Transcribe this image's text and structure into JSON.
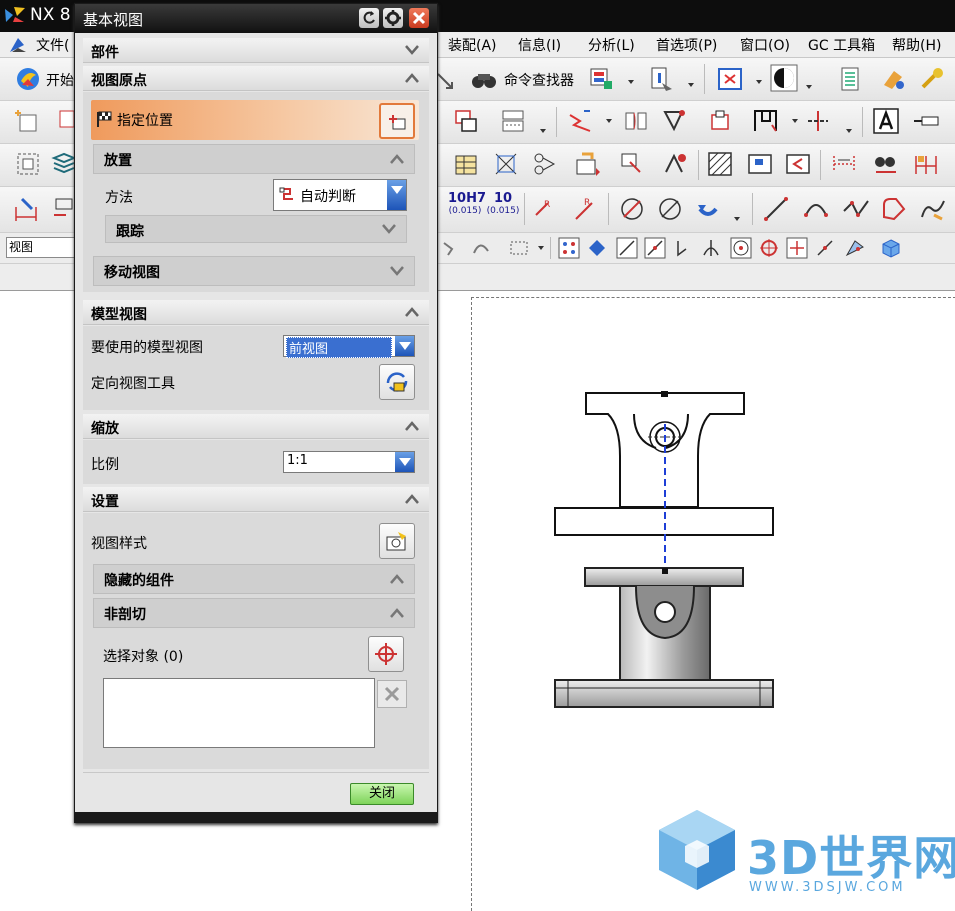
{
  "app": {
    "title": "NX 8"
  },
  "menu": [
    "文件(",
    "装配(A)",
    "信息(I)",
    "分析(L)",
    "首选项(P)",
    "窗口(O)",
    "GC 工具箱",
    "帮助(H)"
  ],
  "toolbar": {
    "start_label": "开始",
    "command_finder": "命令查找器",
    "tol_fit": "10H7",
    "tol_fit_sub": "(0.015)",
    "tol_num": "10",
    "tol_num_sub": "(0.015)"
  },
  "selection": {
    "filter_value": "视图"
  },
  "dialog": {
    "title": "基本视图",
    "sections": {
      "part": "部件",
      "view_origin": "视图原点",
      "model_view": "模型视图",
      "scale": "缩放",
      "settings": "设置"
    },
    "specify_location": "指定位置",
    "placement": {
      "header": "放置",
      "method_label": "方法",
      "method_value": "自动判断",
      "track": "跟踪"
    },
    "move_view": "移动视图",
    "model_view_to_use_label": "要使用的模型视图",
    "model_view_to_use_value": "前视图",
    "orient_view_tool": "定向视图工具",
    "scale_label": "比例",
    "scale_value": "1:1",
    "view_style": "视图样式",
    "hidden_components": "隐藏的组件",
    "non_sectioned": "非剖切",
    "select_objects": "选择对象 (0)",
    "close_button": "关闭"
  },
  "watermark": {
    "text": "3D世界网",
    "url": "WWW.3DSJW.COM"
  },
  "colors": {
    "accent_orange": "#f0a56a",
    "dropdown_blue": "#2b63c8",
    "close_green": "#86d966",
    "centerline_blue": "#1f3fd6"
  }
}
